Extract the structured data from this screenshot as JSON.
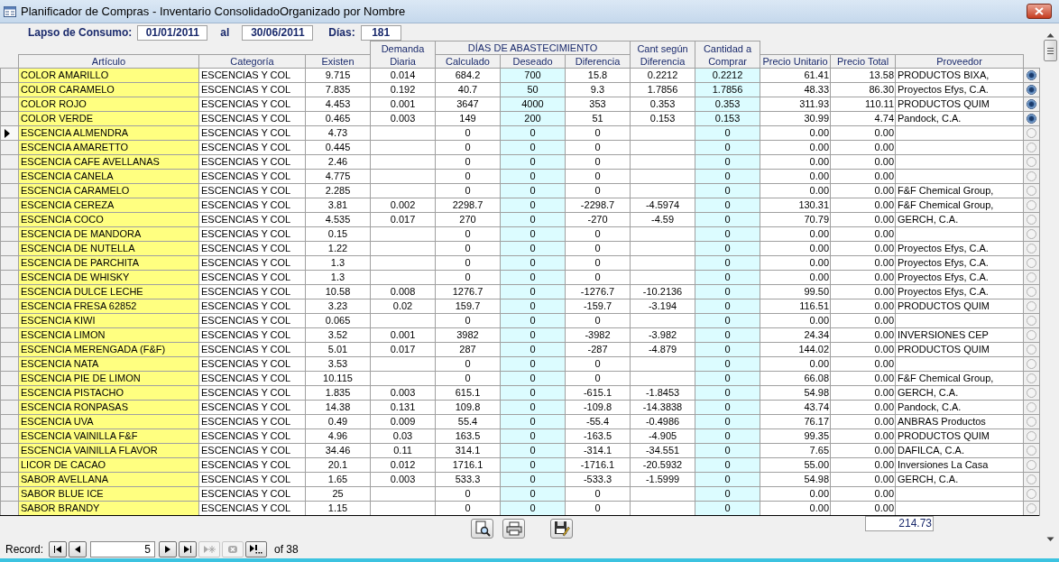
{
  "window": {
    "title": "Planificador de Compras - Inventario ConsolidadoOrganizado por Nombre"
  },
  "filter": {
    "label": "Lapso de Consumo:",
    "from": "01/01/2011",
    "connector": "al",
    "to": "30/06/2011",
    "days_label": "Días:",
    "days": "181"
  },
  "table": {
    "group_label": "DÍAS DE ABASTECIMIENTO",
    "columns": [
      {
        "label": "Artículo",
        "kind": "key"
      },
      {
        "label": "Categoría",
        "kind": "text"
      },
      {
        "label": "Existen",
        "kind": "number"
      },
      {
        "label": "Demanda Diaria",
        "kind": "number",
        "tall": true
      },
      {
        "label": "Calculado",
        "kind": "number",
        "grouped": true
      },
      {
        "label": "Deseado",
        "kind": "input",
        "grouped": true
      },
      {
        "label": "Diferencia",
        "kind": "number",
        "grouped": true
      },
      {
        "label": "Cant según Diferencia",
        "kind": "number",
        "tall": true
      },
      {
        "label": "Cantidad a Comprar",
        "kind": "input",
        "tall": true
      },
      {
        "label": "Precio Unitario",
        "kind": "money"
      },
      {
        "label": "Precio Total",
        "kind": "money"
      },
      {
        "label": "Proveedor",
        "kind": "text"
      }
    ],
    "rows": [
      {
        "cells": [
          "COLOR AMARILLO",
          "ESCENCIAS Y COL",
          "9.715",
          "0.014",
          "684.2",
          "700",
          "15.8",
          "0.2212",
          "0.2212",
          "61.41",
          "13.58",
          "PRODUCTOS BIXA,"
        ],
        "current": false,
        "checked": true
      },
      {
        "cells": [
          "COLOR CARAMELO",
          "ESCENCIAS Y COL",
          "7.835",
          "0.192",
          "40.7",
          "50",
          "9.3",
          "1.7856",
          "1.7856",
          "48.33",
          "86.30",
          "Proyectos Efys, C.A."
        ],
        "current": false,
        "checked": true
      },
      {
        "cells": [
          "COLOR ROJO",
          "ESCENCIAS Y COL",
          "4.453",
          "0.001",
          "3647",
          "4000",
          "353",
          "0.353",
          "0.353",
          "311.93",
          "110.11",
          "PRODUCTOS QUIM"
        ],
        "current": false,
        "checked": true
      },
      {
        "cells": [
          "COLOR VERDE",
          "ESCENCIAS Y COL",
          "0.465",
          "0.003",
          "149",
          "200",
          "51",
          "0.153",
          "0.153",
          "30.99",
          "4.74",
          "Pandock, C.A."
        ],
        "current": false,
        "checked": true
      },
      {
        "cells": [
          "ESCENCIA ALMENDRA",
          "ESCENCIAS Y COL",
          "4.73",
          null,
          "0",
          "0",
          "0",
          null,
          "0",
          "0.00",
          "0.00",
          null
        ],
        "current": true,
        "checked": false
      },
      {
        "cells": [
          "ESCENCIA AMARETTO",
          "ESCENCIAS Y COL",
          "0.445",
          null,
          "0",
          "0",
          "0",
          null,
          "0",
          "0.00",
          "0.00",
          null
        ],
        "current": false,
        "checked": false
      },
      {
        "cells": [
          "ESCENCIA CAFE AVELLANAS",
          "ESCENCIAS Y COL",
          "2.46",
          null,
          "0",
          "0",
          "0",
          null,
          "0",
          "0.00",
          "0.00",
          null
        ],
        "current": false,
        "checked": false
      },
      {
        "cells": [
          "ESCENCIA CANELA",
          "ESCENCIAS Y COL",
          "4.775",
          null,
          "0",
          "0",
          "0",
          null,
          "0",
          "0.00",
          "0.00",
          null
        ],
        "current": false,
        "checked": false
      },
      {
        "cells": [
          "ESCENCIA CARAMELO",
          "ESCENCIAS Y COL",
          "2.285",
          null,
          "0",
          "0",
          "0",
          null,
          "0",
          "0.00",
          "0.00",
          "F&F Chemical Group,"
        ],
        "current": false,
        "checked": false
      },
      {
        "cells": [
          "ESCENCIA CEREZA",
          "ESCENCIAS Y COL",
          "3.81",
          "0.002",
          "2298.7",
          "0",
          "-2298.7",
          "-4.5974",
          "0",
          "130.31",
          "0.00",
          "F&F Chemical Group,"
        ],
        "current": false,
        "checked": false
      },
      {
        "cells": [
          "ESCENCIA COCO",
          "ESCENCIAS Y COL",
          "4.535",
          "0.017",
          "270",
          "0",
          "-270",
          "-4.59",
          "0",
          "70.79",
          "0.00",
          "GERCH, C.A."
        ],
        "current": false,
        "checked": false
      },
      {
        "cells": [
          "ESCENCIA DE MANDORA",
          "ESCENCIAS Y COL",
          "0.15",
          null,
          "0",
          "0",
          "0",
          null,
          "0",
          "0.00",
          "0.00",
          null
        ],
        "current": false,
        "checked": false
      },
      {
        "cells": [
          "ESCENCIA DE NUTELLA",
          "ESCENCIAS Y COL",
          "1.22",
          null,
          "0",
          "0",
          "0",
          null,
          "0",
          "0.00",
          "0.00",
          "Proyectos Efys, C.A."
        ],
        "current": false,
        "checked": false
      },
      {
        "cells": [
          "ESCENCIA DE PARCHITA",
          "ESCENCIAS Y COL",
          "1.3",
          null,
          "0",
          "0",
          "0",
          null,
          "0",
          "0.00",
          "0.00",
          "Proyectos Efys, C.A."
        ],
        "current": false,
        "checked": false
      },
      {
        "cells": [
          "ESCENCIA DE WHISKY",
          "ESCENCIAS Y COL",
          "1.3",
          null,
          "0",
          "0",
          "0",
          null,
          "0",
          "0.00",
          "0.00",
          "Proyectos Efys, C.A."
        ],
        "current": false,
        "checked": false
      },
      {
        "cells": [
          "ESCENCIA DULCE LECHE",
          "ESCENCIAS Y COL",
          "10.58",
          "0.008",
          "1276.7",
          "0",
          "-1276.7",
          "-10.2136",
          "0",
          "99.50",
          "0.00",
          "Proyectos Efys, C.A."
        ],
        "current": false,
        "checked": false
      },
      {
        "cells": [
          "ESCENCIA FRESA 62852",
          "ESCENCIAS Y COL",
          "3.23",
          "0.02",
          "159.7",
          "0",
          "-159.7",
          "-3.194",
          "0",
          "116.51",
          "0.00",
          "PRODUCTOS QUIM"
        ],
        "current": false,
        "checked": false
      },
      {
        "cells": [
          "ESCENCIA KIWI",
          "ESCENCIAS Y COL",
          "0.065",
          null,
          "0",
          "0",
          "0",
          null,
          "0",
          "0.00",
          "0.00",
          null
        ],
        "current": false,
        "checked": false
      },
      {
        "cells": [
          "ESCENCIA LIMON",
          "ESCENCIAS Y COL",
          "3.52",
          "0.001",
          "3982",
          "0",
          "-3982",
          "-3.982",
          "0",
          "24.34",
          "0.00",
          "INVERSIONES CEP"
        ],
        "current": false,
        "checked": false
      },
      {
        "cells": [
          "ESCENCIA MERENGADA (F&F)",
          "ESCENCIAS Y COL",
          "5.01",
          "0.017",
          "287",
          "0",
          "-287",
          "-4.879",
          "0",
          "144.02",
          "0.00",
          "PRODUCTOS QUIM"
        ],
        "current": false,
        "checked": false
      },
      {
        "cells": [
          "ESCENCIA NATA",
          "ESCENCIAS Y COL",
          "3.53",
          null,
          "0",
          "0",
          "0",
          null,
          "0",
          "0.00",
          "0.00",
          null
        ],
        "current": false,
        "checked": false
      },
      {
        "cells": [
          "ESCENCIA PIE DE LIMON",
          "ESCENCIAS Y COL",
          "10.115",
          null,
          "0",
          "0",
          "0",
          null,
          "0",
          "66.08",
          "0.00",
          "F&F Chemical Group,"
        ],
        "current": false,
        "checked": false
      },
      {
        "cells": [
          "ESCENCIA PISTACHO",
          "ESCENCIAS Y COL",
          "1.835",
          "0.003",
          "615.1",
          "0",
          "-615.1",
          "-1.8453",
          "0",
          "54.98",
          "0.00",
          "GERCH, C.A."
        ],
        "current": false,
        "checked": false
      },
      {
        "cells": [
          "ESCENCIA RONPASAS",
          "ESCENCIAS Y COL",
          "14.38",
          "0.131",
          "109.8",
          "0",
          "-109.8",
          "-14.3838",
          "0",
          "43.74",
          "0.00",
          "Pandock, C.A."
        ],
        "current": false,
        "checked": false
      },
      {
        "cells": [
          "ESCENCIA UVA",
          "ESCENCIAS Y COL",
          "0.49",
          "0.009",
          "55.4",
          "0",
          "-55.4",
          "-0.4986",
          "0",
          "76.17",
          "0.00",
          "ANBRAS Productos"
        ],
        "current": false,
        "checked": false
      },
      {
        "cells": [
          "ESCENCIA VAINILLA F&F",
          "ESCENCIAS Y COL",
          "4.96",
          "0.03",
          "163.5",
          "0",
          "-163.5",
          "-4.905",
          "0",
          "99.35",
          "0.00",
          "PRODUCTOS QUIM"
        ],
        "current": false,
        "checked": false
      },
      {
        "cells": [
          "ESCENCIA VAINILLA FLAVOR",
          "ESCENCIAS Y COL",
          "34.46",
          "0.11",
          "314.1",
          "0",
          "-314.1",
          "-34.551",
          "0",
          "7.65",
          "0.00",
          "DAFILCA, C.A."
        ],
        "current": false,
        "checked": false
      },
      {
        "cells": [
          "LICOR DE CACAO",
          "ESCENCIAS Y COL",
          "20.1",
          "0.012",
          "1716.1",
          "0",
          "-1716.1",
          "-20.5932",
          "0",
          "55.00",
          "0.00",
          "Inversiones La Casa"
        ],
        "current": false,
        "checked": false
      },
      {
        "cells": [
          "SABOR AVELLANA",
          "ESCENCIAS Y COL",
          "1.65",
          "0.003",
          "533.3",
          "0",
          "-533.3",
          "-1.5999",
          "0",
          "54.98",
          "0.00",
          "GERCH, C.A."
        ],
        "current": false,
        "checked": false
      },
      {
        "cells": [
          "SABOR BLUE ICE",
          "ESCENCIAS Y COL",
          "25",
          null,
          "0",
          "0",
          "0",
          null,
          "0",
          "0.00",
          "0.00",
          null
        ],
        "current": false,
        "checked": false
      },
      {
        "cells": [
          "SABOR BRANDY",
          "ESCENCIAS Y COL",
          "1.15",
          null,
          "0",
          "0",
          "0",
          null,
          "0",
          "0.00",
          "0.00",
          null
        ],
        "current": false,
        "checked": false
      }
    ],
    "total": "214.73"
  },
  "toolbar": [
    {
      "kind": "preview"
    },
    {
      "kind": "print"
    },
    {
      "kind": "save"
    }
  ],
  "navigation": {
    "label": "Record:",
    "current": "5",
    "count": "of 38",
    "buttons": [
      {
        "kind": "first",
        "disabled": false
      },
      {
        "kind": "previous",
        "disabled": false
      },
      {
        "kind": "next",
        "disabled": false
      },
      {
        "kind": "last",
        "disabled": false
      },
      {
        "kind": "new",
        "disabled": true
      },
      {
        "kind": "delete",
        "disabled": true
      },
      {
        "kind": "more",
        "disabled": false
      }
    ]
  }
}
